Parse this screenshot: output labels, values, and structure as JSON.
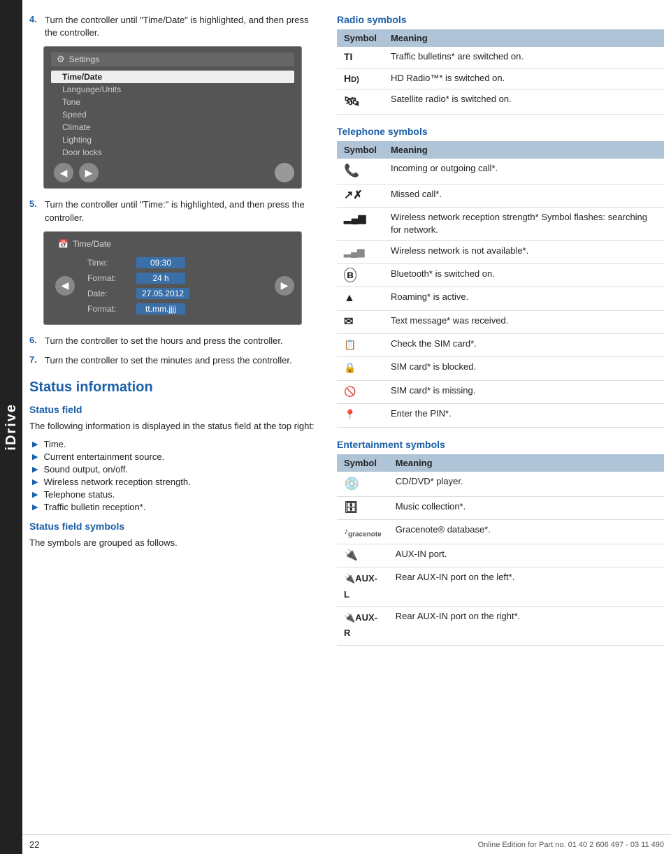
{
  "idrive_label": "iDrive",
  "footer": {
    "page": "22",
    "url": "Online Edition for Part no. 01 40 2 606 497 - 03 11 490"
  },
  "left": {
    "step4": {
      "num": "4.",
      "text": "Turn the controller until \"Time/Date\" is highlighted, and then press the controller."
    },
    "step5": {
      "num": "5.",
      "text": "Turn the controller until \"Time:\" is highlighted, and then press the controller."
    },
    "step6": {
      "num": "6.",
      "text": "Turn the controller to set the hours and press the controller."
    },
    "step7": {
      "num": "7.",
      "text": "Turn the controller to set the minutes and press the controller."
    },
    "screen1": {
      "title": "Settings",
      "items": [
        "Time/Date",
        "Language/Units",
        "Tone",
        "Speed",
        "Climate",
        "Lighting",
        "Door locks"
      ]
    },
    "screen2": {
      "title": "Time/Date",
      "rows": [
        {
          "label": "Time:",
          "value": "09:30"
        },
        {
          "label": "Format:",
          "value": "24 h"
        },
        {
          "label": "Date:",
          "value": "27.05.2012"
        },
        {
          "label": "Format:",
          "value": "tt.mm.jjjj"
        }
      ]
    },
    "status_info": {
      "heading": "Status information",
      "status_field_heading": "Status field",
      "status_field_para": "The following information is displayed in the status field at the top right:",
      "bullets": [
        "Time.",
        "Current entertainment source.",
        "Sound output, on/off.",
        "Wireless network reception strength.",
        "Telephone status.",
        "Traffic bulletin reception*."
      ],
      "status_field_symbols_heading": "Status field symbols",
      "status_field_symbols_para": "The symbols are grouped as follows."
    }
  },
  "right": {
    "radio_symbols": {
      "heading": "Radio symbols",
      "col_symbol": "Symbol",
      "col_meaning": "Meaning",
      "rows": [
        {
          "symbol": "TI",
          "meaning": "Traffic bulletins* are switched on."
        },
        {
          "symbol": "HD)",
          "meaning": "HD Radio™* is switched on."
        },
        {
          "symbol": "★",
          "meaning": "Satellite radio* is switched on."
        }
      ]
    },
    "telephone_symbols": {
      "heading": "Telephone symbols",
      "col_symbol": "Symbol",
      "col_meaning": "Meaning",
      "rows": [
        {
          "symbol": "📞",
          "meaning": "Incoming or outgoing call*."
        },
        {
          "symbol": "↗",
          "meaning": "Missed call*."
        },
        {
          "symbol": "▐▌▌",
          "meaning": "Wireless network reception strength* Symbol flashes: searching for network."
        },
        {
          "symbol": "▐▌▌✗",
          "meaning": "Wireless network is not available*."
        },
        {
          "symbol": "ⓑ",
          "meaning": "Bluetooth* is switched on."
        },
        {
          "symbol": "▲",
          "meaning": "Roaming* is active."
        },
        {
          "symbol": "✉",
          "meaning": "Text message* was received."
        },
        {
          "symbol": "📋",
          "meaning": "Check the SIM card*."
        },
        {
          "symbol": "🔒",
          "meaning": "SIM card* is blocked."
        },
        {
          "symbol": "🚫",
          "meaning": "SIM card* is missing."
        },
        {
          "symbol": "📌",
          "meaning": "Enter the PIN*."
        }
      ]
    },
    "entertainment_symbols": {
      "heading": "Entertainment symbols",
      "col_symbol": "Symbol",
      "col_meaning": "Meaning",
      "rows": [
        {
          "symbol": "💿",
          "meaning": "CD/DVD* player."
        },
        {
          "symbol": "🗄",
          "meaning": "Music collection*."
        },
        {
          "symbol": "♪gracenote",
          "meaning": "Gracenote® database*."
        },
        {
          "symbol": "🔌",
          "meaning": "AUX-IN port."
        },
        {
          "symbol": "🔌AUX-L",
          "meaning": "Rear AUX-IN port on the left*."
        },
        {
          "symbol": "🔌AUX-R",
          "meaning": "Rear AUX-IN port on the right*."
        }
      ]
    }
  }
}
